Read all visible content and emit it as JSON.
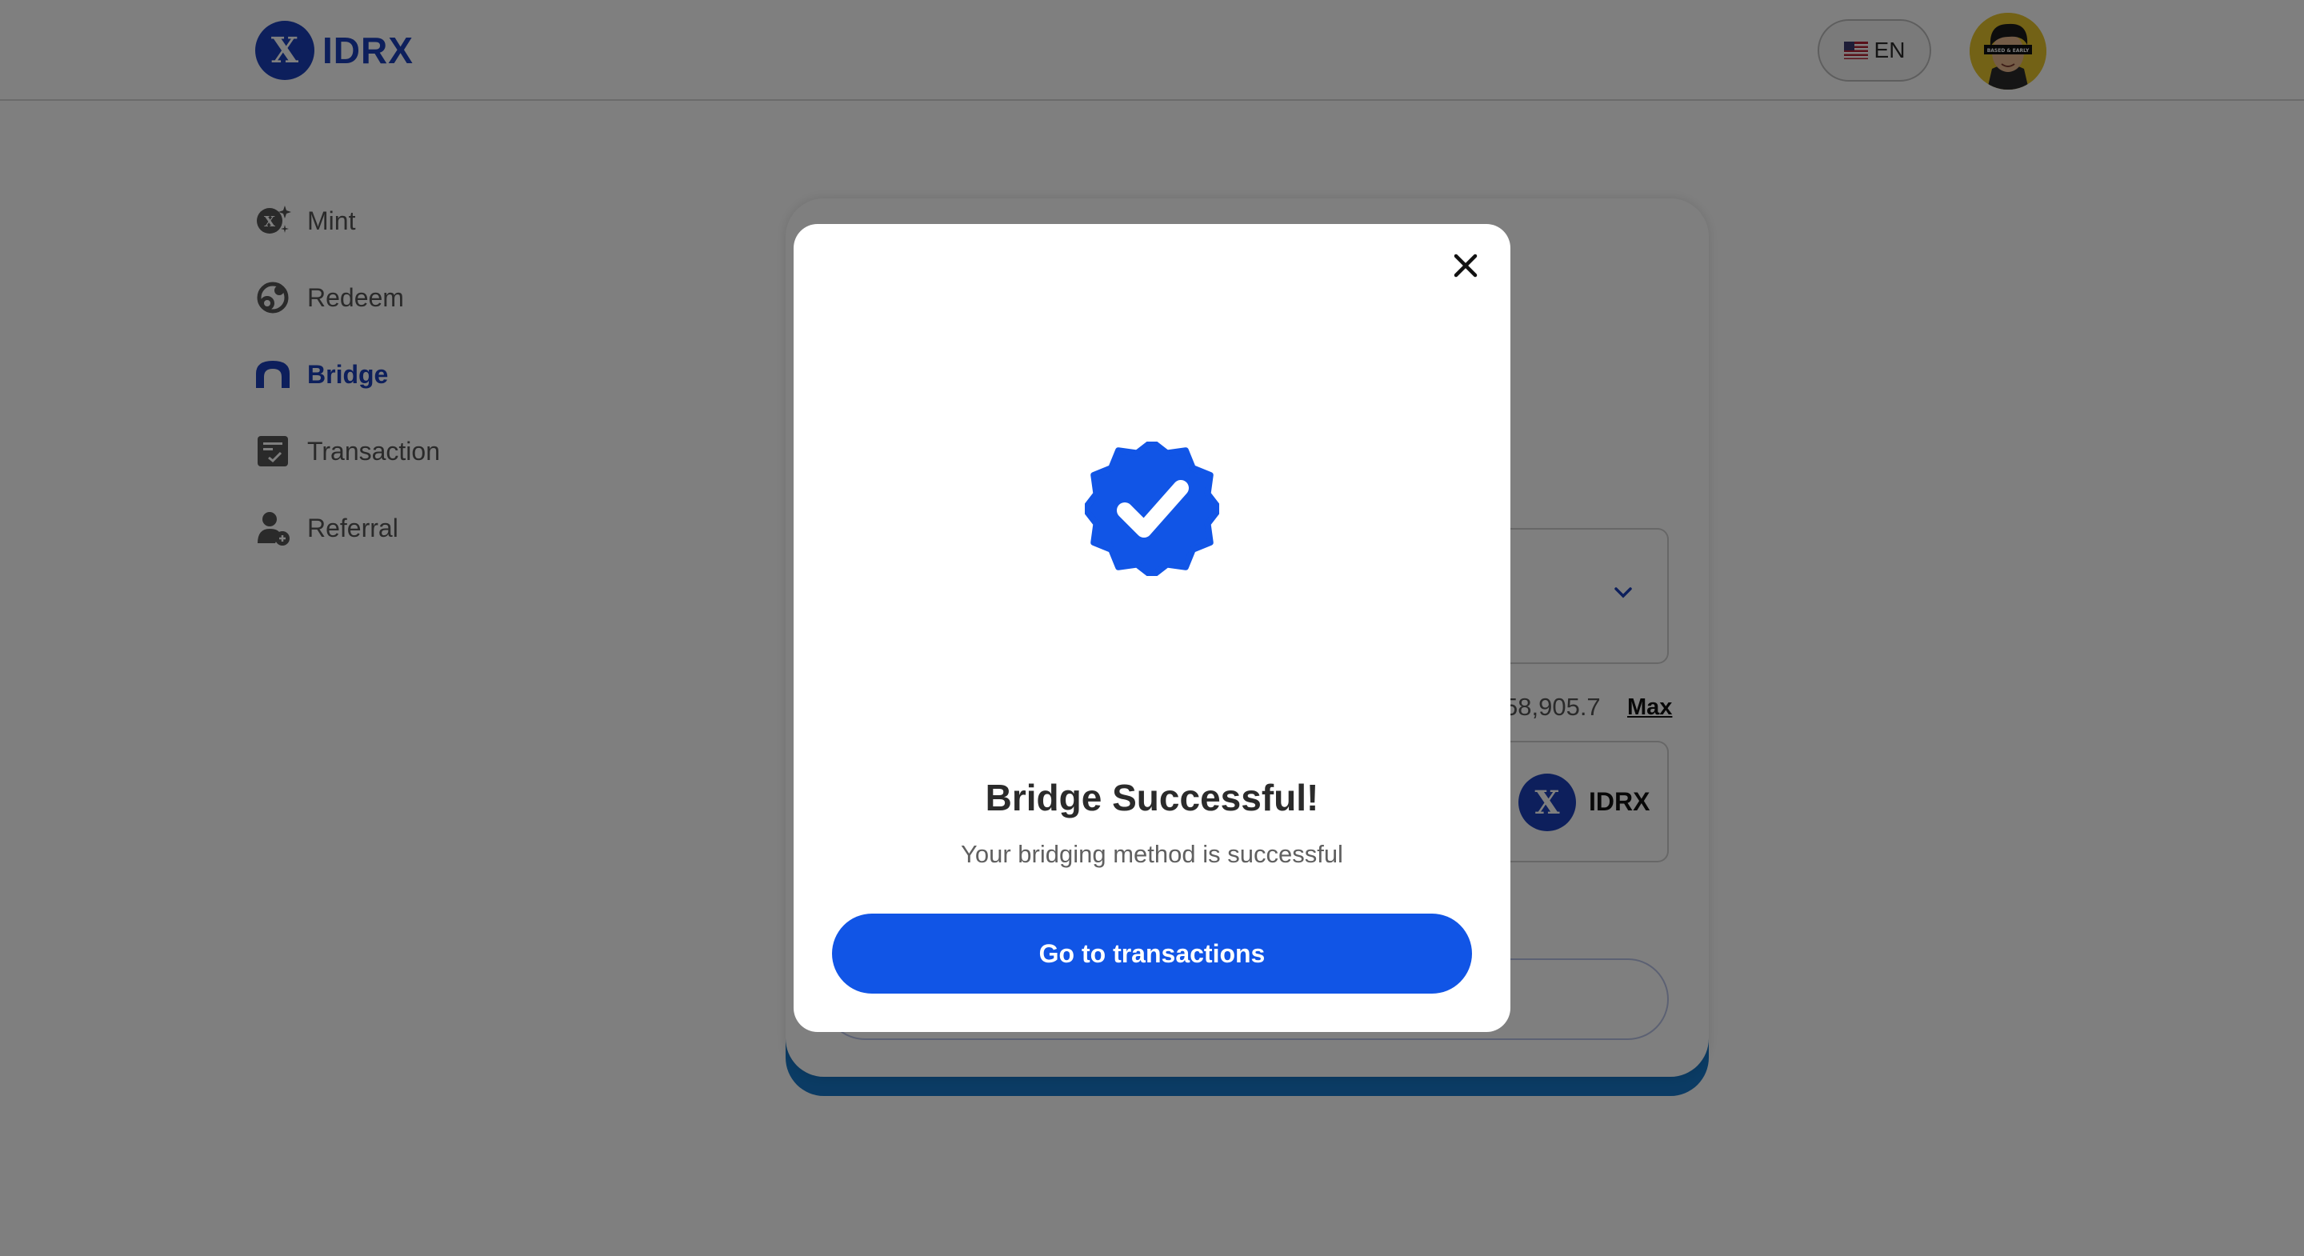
{
  "header": {
    "logo_text": "IDRX",
    "logo_mark": "X",
    "language_label": "EN",
    "avatar_caption": "BASED & EARLY"
  },
  "sidebar": {
    "items": [
      {
        "label": "Mint",
        "icon": "mint-icon",
        "active": false
      },
      {
        "label": "Redeem",
        "icon": "redeem-icon",
        "active": false
      },
      {
        "label": "Bridge",
        "icon": "bridge-icon",
        "active": true
      },
      {
        "label": "Transaction",
        "icon": "transaction-icon",
        "active": false
      },
      {
        "label": "Referral",
        "icon": "referral-icon",
        "active": false
      }
    ]
  },
  "card": {
    "balance_partial": "58,905.7",
    "max_label": "Max",
    "token_label": "IDRX",
    "token_mark": "X"
  },
  "modal": {
    "title": "Bridge Successful!",
    "subtitle": "Your bridging method is successful",
    "primary_button": "Go to transactions"
  },
  "colors": {
    "brand": "#1a3fb8",
    "primary_button": "#1155e6",
    "card_accent": "#1677c8",
    "overlay": "rgba(0,0,0,0.5)"
  }
}
